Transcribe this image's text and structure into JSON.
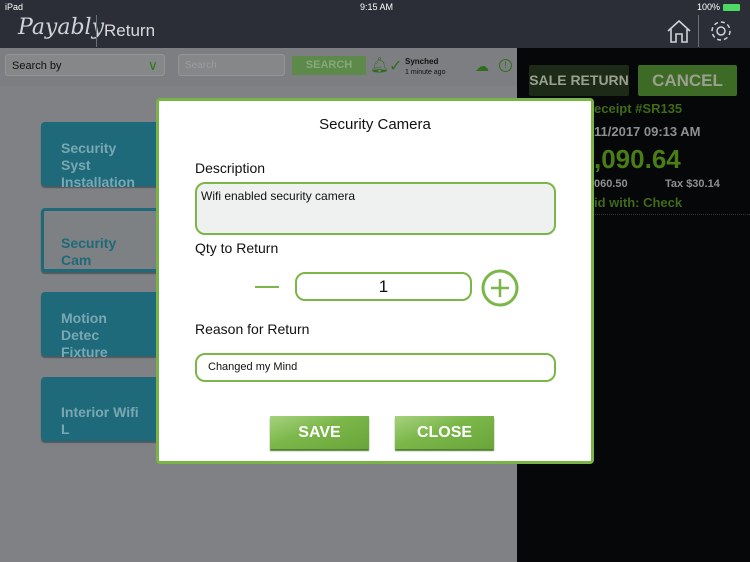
{
  "status": {
    "device": "iPad",
    "time": "9:15 AM",
    "battery": "100%"
  },
  "header": {
    "logo": "Payably",
    "title": "Return"
  },
  "toolbar": {
    "search_by": "Search by",
    "search_placeholder": "Search",
    "search_button": "SEARCH",
    "sync_status": "Synched",
    "sync_time": "1 minute ago"
  },
  "right_panel": {
    "sale_return": "SALE RETURN",
    "cancel": "CANCEL",
    "receipt": "eceipt #SR135",
    "date": "11/2017 09:13 AM",
    "total": ",090.64",
    "subtotal": "060.50",
    "tax": "Tax $30.14",
    "paid_with": "id with: Check"
  },
  "tiles": [
    {
      "label": "Security Syst Installation"
    },
    {
      "label": "Security Cam"
    },
    {
      "label": "Motion Detec Fixture"
    },
    {
      "label": "Interior Wifi L"
    }
  ],
  "modal": {
    "title": "Security Camera",
    "description_label": "Description",
    "description_value": "Wifi enabled security camera",
    "qty_label": "Qty to Return",
    "qty_value": "1",
    "reason_label": "Reason for Return",
    "reason_value": "Changed my Mind",
    "save": "SAVE",
    "close": "CLOSE"
  },
  "colors": {
    "accent": "#7ab648",
    "tile": "#1e6a7a",
    "header": "#2b2e36"
  }
}
